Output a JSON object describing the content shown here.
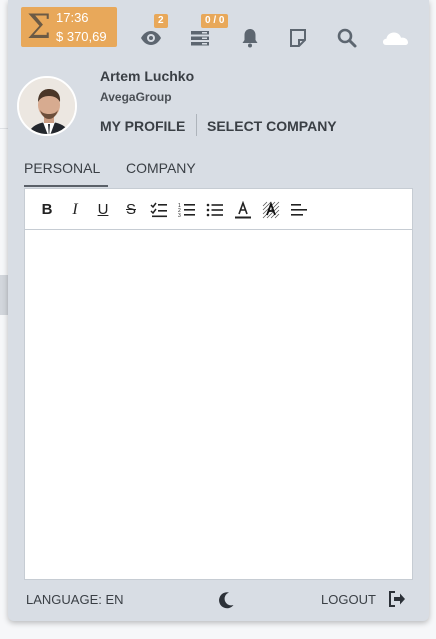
{
  "timer": {
    "time": "17:36",
    "amount": "$ 370,69",
    "icon": "sigma-icon"
  },
  "topbar": {
    "watch_badge": "2",
    "tasks_badge": "0 / 0",
    "icons": [
      "eye-icon",
      "list-icon",
      "bell-icon",
      "note-icon",
      "search-icon",
      "cloud-icon"
    ]
  },
  "user": {
    "name": "Artem Luchko",
    "company": "AvegaGroup"
  },
  "links": {
    "my_profile": "MY PROFILE",
    "select_company": "SELECT COMPANY"
  },
  "tabs": [
    {
      "label": "PERSONAL",
      "active": true
    },
    {
      "label": "COMPANY",
      "active": false
    }
  ],
  "editor": {
    "tools": [
      "bold",
      "italic",
      "underline",
      "strikethrough",
      "checklist",
      "ordered-list",
      "bullet-list",
      "text-color",
      "highlight",
      "align"
    ],
    "content": ""
  },
  "footer": {
    "language": "LANGUAGE: EN",
    "logout": "LOGOUT"
  },
  "colors": {
    "accent": "#e8a85a",
    "panel": "#d8dde4",
    "text": "#3a3f45"
  }
}
